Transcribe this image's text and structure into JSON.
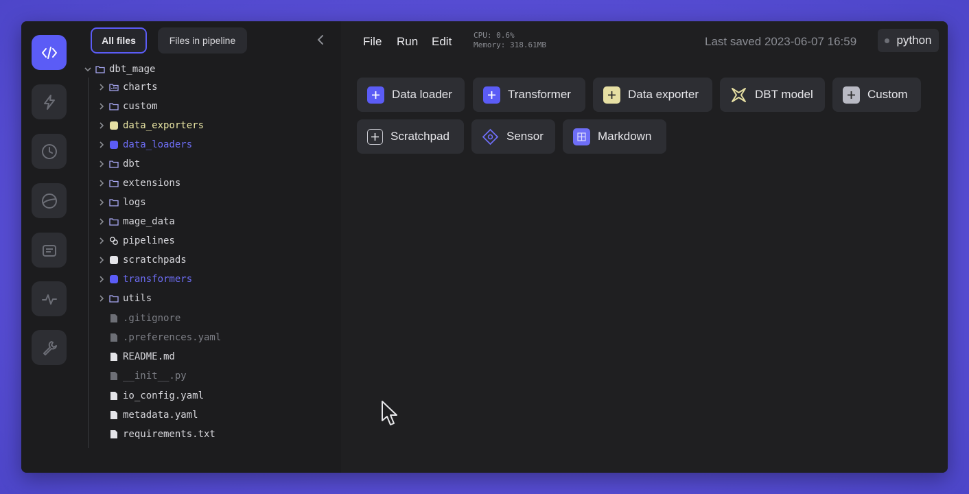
{
  "tabs": {
    "all_files": "All files",
    "files_in_pipeline": "Files in pipeline"
  },
  "menu": {
    "file": "File",
    "run": "Run",
    "edit": "Edit"
  },
  "system": {
    "cpu": "CPU: 0.6%",
    "memory": "Memory: 318.61MB"
  },
  "last_saved": "Last saved 2023-06-07 16:59",
  "kernel": "python",
  "tree": {
    "root": "dbt_mage",
    "items": [
      {
        "name": "charts",
        "type": "folder"
      },
      {
        "name": "custom",
        "type": "folder"
      },
      {
        "name": "data_exporters",
        "type": "exporter"
      },
      {
        "name": "data_loaders",
        "type": "loader"
      },
      {
        "name": "dbt",
        "type": "folder"
      },
      {
        "name": "extensions",
        "type": "folder"
      },
      {
        "name": "logs",
        "type": "folder"
      },
      {
        "name": "mage_data",
        "type": "folder"
      },
      {
        "name": "pipelines",
        "type": "pipelines"
      },
      {
        "name": "scratchpads",
        "type": "scratchpad"
      },
      {
        "name": "transformers",
        "type": "transformer"
      },
      {
        "name": "utils",
        "type": "folder"
      },
      {
        "name": ".gitignore",
        "type": "file-muted"
      },
      {
        "name": ".preferences.yaml",
        "type": "file-muted"
      },
      {
        "name": "README.md",
        "type": "file"
      },
      {
        "name": "__init__.py",
        "type": "file-muted"
      },
      {
        "name": "io_config.yaml",
        "type": "file"
      },
      {
        "name": "metadata.yaml",
        "type": "file"
      },
      {
        "name": "requirements.txt",
        "type": "file"
      }
    ]
  },
  "blocks": [
    {
      "label": "Data loader",
      "icon": "plus-icon",
      "color": "#5b5cf6"
    },
    {
      "label": "Transformer",
      "icon": "plus-icon",
      "color": "#5b5cf6"
    },
    {
      "label": "Data exporter",
      "icon": "plus-icon",
      "color": "#e6dfa3"
    },
    {
      "label": "DBT model",
      "icon": "dbt-icon",
      "color": "#e6dfa3"
    },
    {
      "label": "Custom",
      "icon": "plus-icon",
      "color": "#b9bac4"
    },
    {
      "label": "Scratchpad",
      "icon": "plus-icon",
      "color": "#2d2e33"
    },
    {
      "label": "Sensor",
      "icon": "sensor-icon",
      "color": "#6e6ef7"
    },
    {
      "label": "Markdown",
      "icon": "markdown-icon",
      "color": "#6e6ef7"
    }
  ]
}
